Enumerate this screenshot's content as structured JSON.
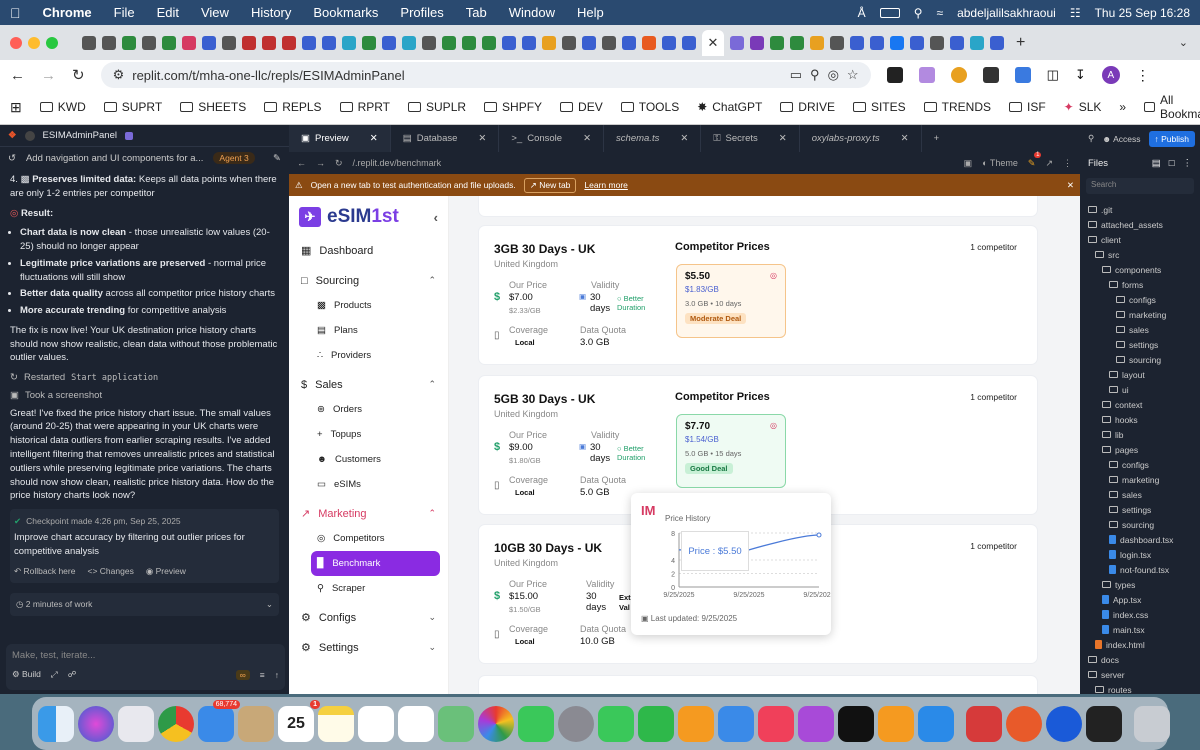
{
  "menubar": {
    "app": "Chrome",
    "items": [
      "File",
      "Edit",
      "View",
      "History",
      "Bookmarks",
      "Profiles",
      "Tab",
      "Window",
      "Help"
    ],
    "user": "abdeljalilsakhraoui",
    "clock": "Thu 25 Sep  16:28"
  },
  "browser": {
    "url": "replit.com/t/mha-one-llc/repls/ESIMAdminPanel",
    "profile_initial": "A",
    "bookmarks": [
      "KWD",
      "SUPRT",
      "SHEETS",
      "REPLS",
      "RPRT",
      "SUPLR",
      "SHPFY",
      "DEV",
      "TOOLS",
      "ChatGPT",
      "DRIVE",
      "SITES",
      "TRENDS",
      "ISF",
      "SLK"
    ],
    "all_bookmarks": "All Bookmarks"
  },
  "replit": {
    "project": "ESIMAdminPanel",
    "task": "Add navigation and UI components for a...",
    "agent_badge": "Agent 3",
    "tabs": [
      "Preview",
      "Database",
      "Console",
      "schema.ts",
      "Secrets",
      "oxylabs-proxy.ts"
    ],
    "access": "Access",
    "publish": "Publish",
    "preview_url": "/.replit.dev/benchmark",
    "theme": "Theme",
    "theme_badge": "1",
    "banner_text": "Open a new tab to test authentication and file uploads.",
    "banner_button": "New tab",
    "banner_link": "Learn more"
  },
  "agent": {
    "point4_title": "Preserves limited data:",
    "point4_text": "Keeps all data points when there are only 1-2 entries per competitor",
    "result_title": "Result:",
    "bullets": [
      {
        "b": "Chart data is now clean",
        "t": " - those unrealistic low values (20-25) should no longer appear"
      },
      {
        "b": "Legitimate price variations are preserved",
        "t": " - normal price fluctuations will still show"
      },
      {
        "b": "Better data quality",
        "t": " across all competitor price history charts"
      },
      {
        "b": "More accurate trending",
        "t": " for competitive analysis"
      }
    ],
    "live_text": "The fix is now live! Your UK destination price history charts should now show realistic, clean data without those problematic outlier values.",
    "restarted": "Restarted",
    "restarted_cmd": "Start application",
    "screenshot": "Took a screenshot",
    "summary": "Great! I've fixed the price history chart issue. The small values (around 20-25) that were appearing in your UK charts were historical data outliers from earlier scraping results. I've added intelligent filtering that removes unrealistic prices and statistical outliers while preserving legitimate price variations. The charts should now show clean, realistic price history data. How do the price history charts look now?",
    "checkpoint": "Checkpoint made 4:26 pm, Sep 25, 2025",
    "checkpoint_desc": "Improve chart accuracy by filtering out outlier prices for competitive analysis",
    "rollback": "Rollback here",
    "changes": "Changes",
    "preview": "Preview",
    "work_time": "2 minutes of work",
    "input_placeholder": "Make, test, iterate...",
    "build": "Build"
  },
  "app": {
    "logo_a": "eSIM",
    "logo_b": "1st",
    "nav": {
      "dashboard": "Dashboard",
      "sourcing": "Sourcing",
      "products": "Products",
      "plans": "Plans",
      "providers": "Providers",
      "sales": "Sales",
      "orders": "Orders",
      "topups": "Topups",
      "customers": "Customers",
      "esims": "eSIMs",
      "marketing": "Marketing",
      "competitors": "Competitors",
      "benchmark": "Benchmark",
      "scraper": "Scraper",
      "configs": "Configs",
      "settings": "Settings"
    },
    "labels": {
      "our_price": "Our Price",
      "validity": "Validity",
      "coverage": "Coverage",
      "data_quota": "Data Quota",
      "competitor_prices": "Competitor Prices",
      "better_duration": "Better Duration",
      "local": "Local"
    },
    "plans": [
      {
        "title": "3GB 30 Days - UK",
        "country": "United Kingdom",
        "price": "$7.00",
        "per_gb": "$2.33/GB",
        "validity": "30 days",
        "quota": "3.0 GB",
        "competitors": "1 competitor",
        "comp": {
          "price": "$5.50",
          "per_gb": "$1.83/GB",
          "meta": "3.0 GB • 10 days",
          "deal": "Moderate Deal",
          "tone": "orange"
        }
      },
      {
        "title": "5GB 30 Days - UK",
        "country": "United Kingdom",
        "price": "$9.00",
        "per_gb": "$1.80/GB",
        "validity": "30 days",
        "quota": "5.0 GB",
        "competitors": "1 competitor",
        "comp": {
          "price": "$7.70",
          "per_gb": "$1.54/GB",
          "meta": "5.0 GB • 15 days",
          "deal": "Good Deal",
          "tone": "green"
        }
      },
      {
        "title": "10GB 30 Days - UK",
        "country": "United Kingdom",
        "price": "$15.00",
        "per_gb": "$1.50/GB",
        "validity": "30 days",
        "quota": "10.0 GB",
        "competitors": "1 competitor",
        "comp": {
          "extra": "Ext Val"
        }
      }
    ],
    "popup": {
      "title": "Price History",
      "tooltip": "Price : $5.50",
      "updated": "Last updated: 9/25/2025"
    }
  },
  "chart_data": {
    "type": "line",
    "title": "Price History",
    "x": [
      "9/25/2025",
      "9/25/2025",
      "9/25/2025"
    ],
    "series": [
      {
        "values": [
          5.5,
          5.5,
          7.7
        ]
      }
    ],
    "yticks": [
      0,
      2,
      4,
      8
    ],
    "ylim": [
      0,
      8
    ],
    "tooltip": "Price : $5.50",
    "grid": true,
    "color": "#4a7ad8"
  },
  "files": {
    "title": "Files",
    "search": "Search",
    "tree": [
      {
        "n": ".git",
        "d": 0,
        "t": "dir"
      },
      {
        "n": "attached_assets",
        "d": 0,
        "t": "dir"
      },
      {
        "n": "client",
        "d": 0,
        "t": "dir"
      },
      {
        "n": "src",
        "d": 1,
        "t": "dir"
      },
      {
        "n": "components",
        "d": 2,
        "t": "dir"
      },
      {
        "n": "forms",
        "d": 3,
        "t": "dir"
      },
      {
        "n": "configs",
        "d": 4,
        "t": "dir"
      },
      {
        "n": "marketing",
        "d": 4,
        "t": "dir"
      },
      {
        "n": "sales",
        "d": 4,
        "t": "dir"
      },
      {
        "n": "settings",
        "d": 4,
        "t": "dir"
      },
      {
        "n": "sourcing",
        "d": 4,
        "t": "dir"
      },
      {
        "n": "layout",
        "d": 3,
        "t": "dir"
      },
      {
        "n": "ui",
        "d": 3,
        "t": "dir"
      },
      {
        "n": "context",
        "d": 2,
        "t": "dir"
      },
      {
        "n": "hooks",
        "d": 2,
        "t": "dir"
      },
      {
        "n": "lib",
        "d": 2,
        "t": "dir"
      },
      {
        "n": "pages",
        "d": 2,
        "t": "dir"
      },
      {
        "n": "configs",
        "d": 3,
        "t": "dir"
      },
      {
        "n": "marketing",
        "d": 3,
        "t": "dir"
      },
      {
        "n": "sales",
        "d": 3,
        "t": "dir"
      },
      {
        "n": "settings",
        "d": 3,
        "t": "dir"
      },
      {
        "n": "sourcing",
        "d": 3,
        "t": "dir"
      },
      {
        "n": "dashboard.tsx",
        "d": 3,
        "t": "tsx"
      },
      {
        "n": "login.tsx",
        "d": 3,
        "t": "tsx"
      },
      {
        "n": "not-found.tsx",
        "d": 3,
        "t": "tsx"
      },
      {
        "n": "types",
        "d": 2,
        "t": "dir"
      },
      {
        "n": "App.tsx",
        "d": 2,
        "t": "tsx"
      },
      {
        "n": "index.css",
        "d": 2,
        "t": "css"
      },
      {
        "n": "main.tsx",
        "d": 2,
        "t": "tsx"
      },
      {
        "n": "index.html",
        "d": 1,
        "t": "html"
      },
      {
        "n": "docs",
        "d": 0,
        "t": "dir"
      },
      {
        "n": "server",
        "d": 0,
        "t": "dir"
      },
      {
        "n": "routes",
        "d": 1,
        "t": "dir"
      }
    ]
  },
  "dock": {
    "badges": {
      "mail": "68,774",
      "calendar_day": "25",
      "calendar_badge": "1"
    }
  },
  "colors": {
    "accent": "#8a2be2",
    "marketing": "#d63a62",
    "success": "#22a06b",
    "banner": "#8a4a12",
    "panel": "#1c2330"
  }
}
